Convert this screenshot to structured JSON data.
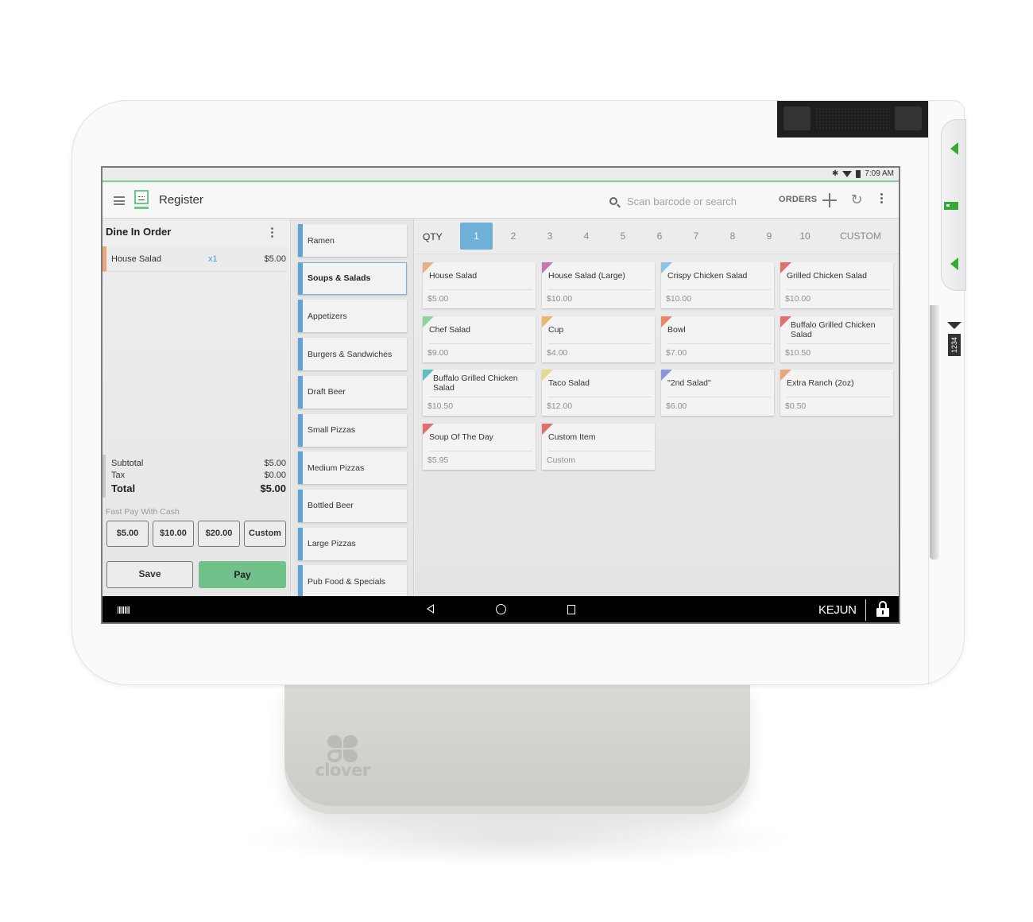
{
  "device": {
    "brand": "clover",
    "card_slot_label": "1234"
  },
  "statusbar": {
    "time": "7:09 AM",
    "icons": [
      "bluetooth-icon",
      "wifi-icon",
      "battery-icon"
    ]
  },
  "appbar": {
    "title": "Register",
    "search_placeholder": "Scan barcode or search",
    "orders_label": "ORDERS",
    "icons": [
      "menu-icon",
      "register-icon",
      "search-icon",
      "plus-icon",
      "refresh-icon",
      "kebab-icon"
    ]
  },
  "order": {
    "title": "Dine In Order",
    "line_items": [
      {
        "name": "House Salad",
        "qty": "x1",
        "price": "$5.00",
        "color": "#e8a67c"
      }
    ],
    "totals": {
      "subtotal_label": "Subtotal",
      "subtotal": "$5.00",
      "tax_label": "Tax",
      "tax": "$0.00",
      "total_label": "Total",
      "total": "$5.00"
    },
    "fast_pay_label": "Fast Pay With Cash",
    "fast_pay_buttons": [
      "$5.00",
      "$10.00",
      "$20.00",
      "Custom"
    ],
    "save_label": "Save",
    "pay_label": "Pay"
  },
  "categories": [
    {
      "label": "Ramen",
      "active": false
    },
    {
      "label": "Soups & Salads",
      "active": true
    },
    {
      "label": "Appetizers",
      "active": false
    },
    {
      "label": "Burgers & Sandwiches",
      "active": false
    },
    {
      "label": "Draft Beer",
      "active": false
    },
    {
      "label": "Small Pizzas",
      "active": false
    },
    {
      "label": "Medium Pizzas",
      "active": false
    },
    {
      "label": "Bottled Beer",
      "active": false
    },
    {
      "label": "Large Pizzas",
      "active": false
    },
    {
      "label": "Pub Food & Specials",
      "active": false
    }
  ],
  "quantity": {
    "label": "QTY",
    "options": [
      "1",
      "2",
      "3",
      "4",
      "5",
      "6",
      "7",
      "8",
      "9",
      "10",
      "CUSTOM"
    ],
    "selected": "1"
  },
  "items": [
    {
      "name": "House Salad",
      "price": "$5.00",
      "color": "#e8b08a"
    },
    {
      "name": "House Salad (Large)",
      "price": "$10.00",
      "color": "#c07aa6"
    },
    {
      "name": "Crispy Chicken Salad",
      "price": "$10.00",
      "color": "#8ec3e6"
    },
    {
      "name": "Grilled Chicken Salad",
      "price": "$10.00",
      "color": "#e07070"
    },
    {
      "name": "Chef Salad",
      "price": "$9.00",
      "color": "#8dd3a0"
    },
    {
      "name": "Cup",
      "price": "$4.00",
      "color": "#e5b96c"
    },
    {
      "name": "Bowl",
      "price": "$7.00",
      "color": "#e8886a"
    },
    {
      "name": "Buffalo Grilled Chicken Salad",
      "price": "$10.50",
      "color": "#e07070"
    },
    {
      "name": "Buffalo Grilled Chicken Salad",
      "price": "$10.50",
      "color": "#5fbfc0"
    },
    {
      "name": "Taco Salad",
      "price": "$12.00",
      "color": "#e6d98a"
    },
    {
      "name": "\"2nd Salad\"",
      "price": "$6.00",
      "color": "#8a98d8"
    },
    {
      "name": "Extra Ranch (2oz)",
      "price": "$0.50",
      "color": "#eba57a"
    },
    {
      "name": "Soup Of The Day",
      "price": "$5.95",
      "color": "#e07070"
    },
    {
      "name": "Custom Item",
      "price": "Custom",
      "color": "#e07070"
    }
  ],
  "navbar": {
    "user": "KEJUN",
    "icons": [
      "barcode-icon",
      "back-icon",
      "home-icon",
      "recents-icon",
      "lock-icon"
    ]
  }
}
